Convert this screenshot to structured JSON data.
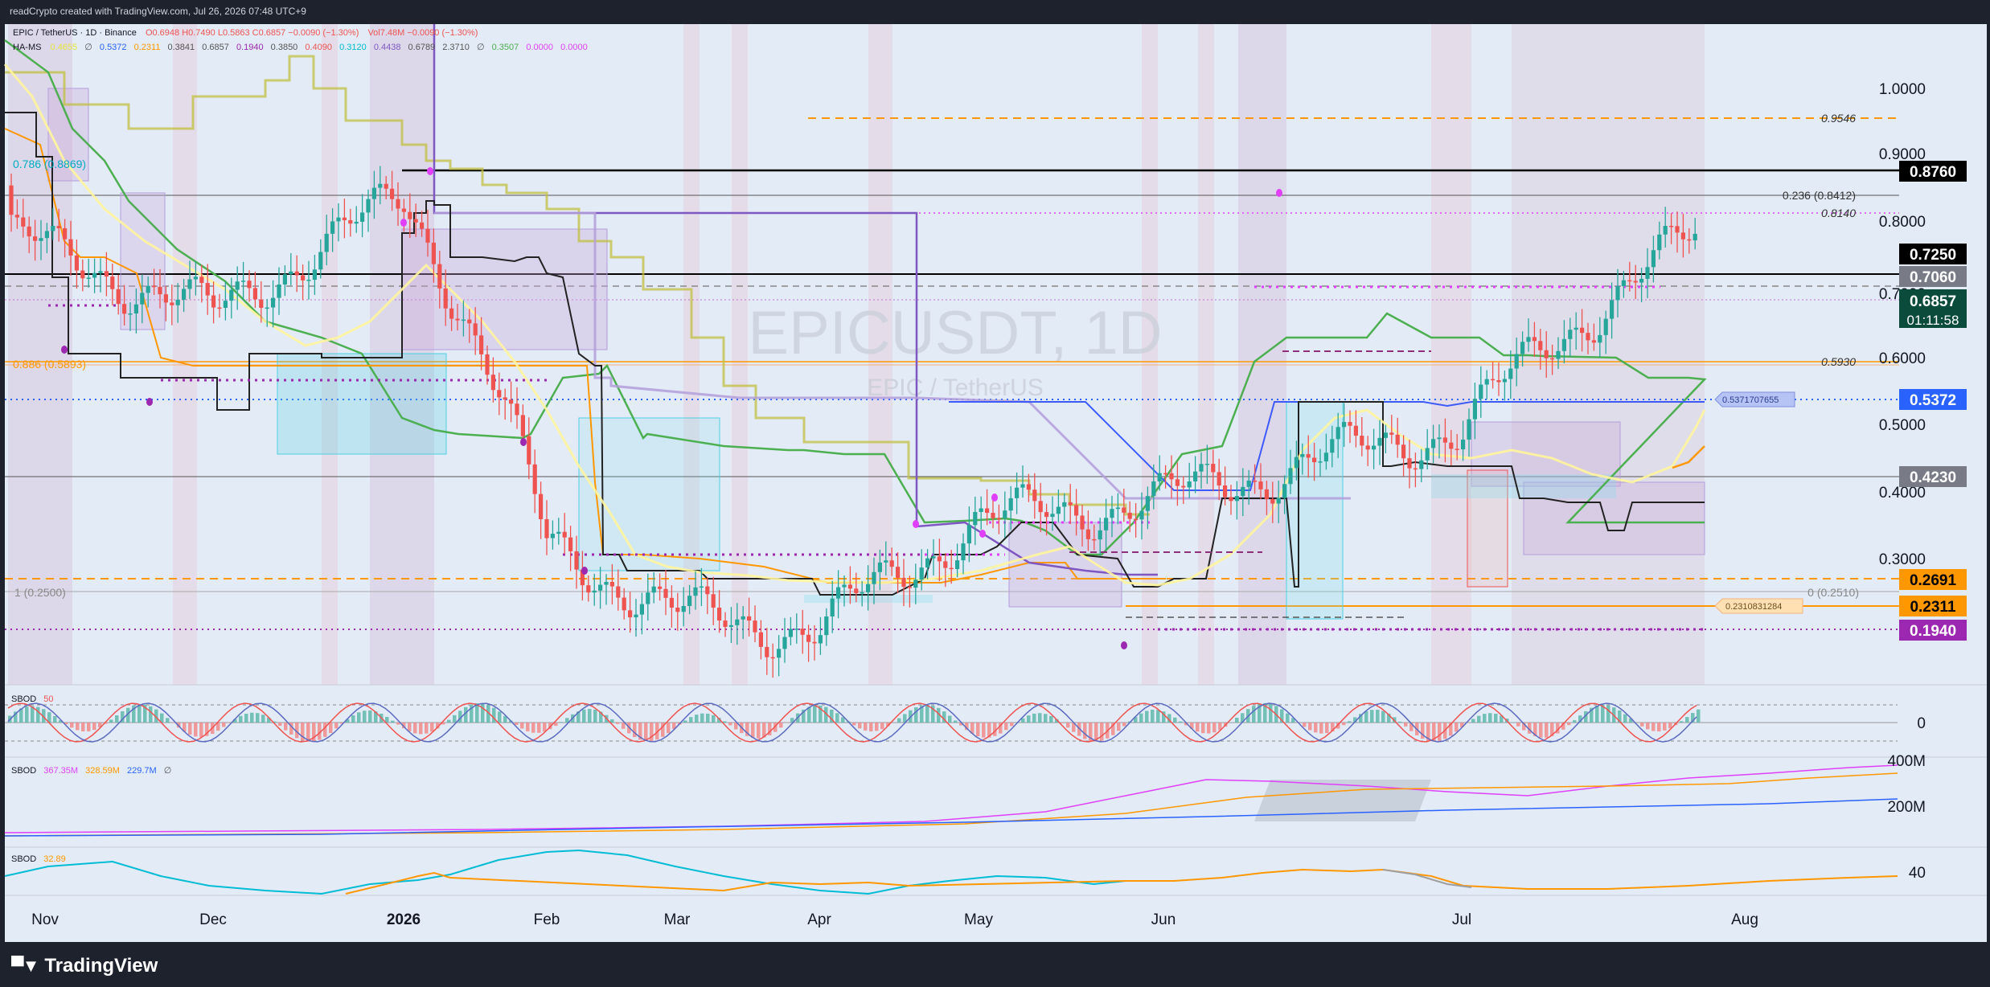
{
  "header": {
    "creator": "readCrypto created with TradingView.com, Jul 26, 2026 07:48 UTC+9",
    "symbol_line": "EPIC / TetherUS · 1D · Binance",
    "ohlc": "O0.6948 H0.7490 L0.5863 C0.6857 −0.0090 (−1.30%)",
    "volume": "Vol7.48M −0.0090 (−1.30%)",
    "indicator_name": "HA-MS",
    "indicator_values": [
      "0.4655",
      "∅",
      "0.5372",
      "0.2311",
      "0.3841",
      "0.6857",
      "0.1940",
      "0.3850",
      "0.4090",
      "0.3120",
      "0.4438",
      "0.6789",
      "2.3710",
      "∅",
      "0.3507",
      "0.0000",
      "0.0000"
    ]
  },
  "watermark": {
    "ticker": "EPICUSDT, 1D",
    "name": "EPIC / TetherUS"
  },
  "footer": {
    "brand": "TradingView"
  },
  "colors": {
    "up": "#26a69a",
    "down": "#ef5350",
    "bg": "#e3ebf6",
    "frame": "#1e222d"
  },
  "chart_data": [
    {
      "type": "candlestick",
      "title": "EPICUSDT, 1D",
      "x_ticks": [
        "Nov",
        "Dec",
        "2026",
        "Feb",
        "Mar",
        "Apr",
        "May",
        "Jun",
        "Jul",
        "Aug"
      ],
      "y_ticks": [
        "1.0000",
        "0.9000",
        "0.8000",
        "0.7000",
        "0.6000",
        "0.5000",
        "0.4000",
        "0.3000"
      ],
      "ylim": [
        0.15,
        1.08
      ],
      "scale": "log",
      "last_price": "0.6857",
      "countdown": "01:11:58",
      "price_labels": [
        {
          "value": 0.876,
          "text": "0.8760",
          "color": "#000000",
          "text_color": "#ffffff"
        },
        {
          "value": 0.725,
          "text": "0.7250",
          "color": "#000000",
          "text_color": "#ffffff"
        },
        {
          "value": 0.706,
          "text": "0.7060",
          "color": "#787b86",
          "text_color": "#ffffff"
        },
        {
          "value": 0.5372,
          "text": "0.5372",
          "color": "#2962ff",
          "text_color": "#ffffff"
        },
        {
          "value": 0.423,
          "text": "0.4230",
          "color": "#787b86",
          "text_color": "#ffffff"
        },
        {
          "value": 0.2691,
          "text": "0.2691",
          "color": "#ff9800",
          "text_color": "#000000"
        },
        {
          "value": 0.2311,
          "text": "0.2311",
          "color": "#ff9800",
          "text_color": "#000000"
        },
        {
          "value": 0.194,
          "text": "0.1940",
          "color": "#9c27b0",
          "text_color": "#ffffff"
        }
      ],
      "annotations": [
        {
          "text": "0.9546",
          "value": 0.9546
        },
        {
          "text": "0.236 (0.8412)",
          "value": 0.8412
        },
        {
          "text": "0.8140",
          "value": 0.814
        },
        {
          "text": "0.5930",
          "value": 0.593
        },
        {
          "text": "0.786 (0.8869)",
          "value": 0.8869
        },
        {
          "text": "0.886 (0.5893)",
          "value": 0.5893
        },
        {
          "text": "1 (0.2500)",
          "value": 0.25
        },
        {
          "text": "0 (0.2510)",
          "value": 0.251
        },
        {
          "text": "0.5371707655",
          "value": 0.5372
        },
        {
          "text": "0.2310831284",
          "value": 0.2311
        }
      ],
      "key_points": [
        {
          "date": "Nov",
          "close": 0.66
        },
        {
          "date": "Dec",
          "close": 0.56
        },
        {
          "date": "2026",
          "close": 0.75
        },
        {
          "date": "Feb",
          "close": 0.31
        },
        {
          "date": "Mar",
          "close": 0.26
        },
        {
          "date": "Apr",
          "close": 0.25
        },
        {
          "date": "May",
          "close": 0.33
        },
        {
          "date": "Jun",
          "close": 0.35
        },
        {
          "date": "Jul",
          "close": 0.42
        },
        {
          "date": "Jul 25",
          "close": 0.6857
        }
      ]
    },
    {
      "type": "histogram",
      "title": "SBOD",
      "values_text": "50",
      "y_ticks": [
        "0"
      ]
    },
    {
      "type": "line",
      "title": "SBOD",
      "values_text": [
        "367.35M",
        "328.59M",
        "229.7M",
        "∅"
      ],
      "y_ticks": [
        "400M",
        "200M"
      ]
    },
    {
      "type": "line",
      "title": "SBOD",
      "values_text": "32.89",
      "y_ticks": [
        "40"
      ]
    }
  ]
}
